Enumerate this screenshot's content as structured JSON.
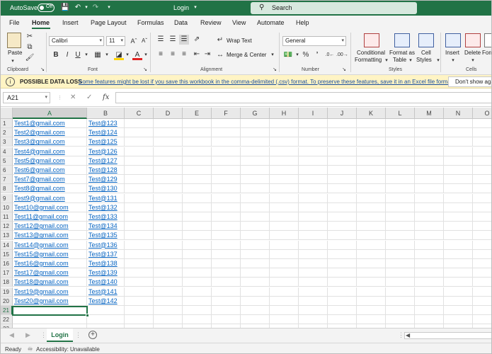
{
  "titlebar": {
    "autosave_label": "AutoSave",
    "autosave_state": "Off",
    "title": "Login",
    "search_placeholder": "Search"
  },
  "tabs": [
    "File",
    "Home",
    "Insert",
    "Page Layout",
    "Formulas",
    "Data",
    "Review",
    "View",
    "Automate",
    "Help"
  ],
  "active_tab": "Home",
  "ribbon": {
    "paste_label": "Paste",
    "clipboard_group": "Clipboard",
    "font_name": "Calibri",
    "font_size": "11",
    "bold": "B",
    "italic": "I",
    "underline": "U",
    "font_group": "Font",
    "wrap_text": "Wrap Text",
    "merge_center": "Merge & Center",
    "alignment_group": "Alignment",
    "number_format": "General",
    "number_group": "Number",
    "conditional_formatting_1": "Conditional",
    "conditional_formatting_2": "Formatting",
    "format_as_table_1": "Format as",
    "format_as_table_2": "Table",
    "cell_styles_1": "Cell",
    "cell_styles_2": "Styles",
    "styles_group": "Styles",
    "insert": "Insert",
    "delete": "Delete",
    "format": "Form",
    "cells_group": "Cells"
  },
  "infobar": {
    "heading": "POSSIBLE DATA LOSS",
    "message": "Some features might be lost if you save this workbook in the comma-delimited (.csv) format. To preserve these features, save it in an Excel file format.",
    "button": "Don't show aga"
  },
  "formula_bar": {
    "name_box": "A21",
    "fx": "fx",
    "value": ""
  },
  "columns": [
    "A",
    "B",
    "C",
    "D",
    "E",
    "F",
    "G",
    "H",
    "I",
    "J",
    "K",
    "L",
    "M",
    "N",
    "O"
  ],
  "rows": [
    [
      "Test1@gmail.com",
      "Test@123"
    ],
    [
      "Test2@gmail.com",
      "Test@124"
    ],
    [
      "Test3@gmail.com",
      "Test@125"
    ],
    [
      "Test4@gmail.com",
      "Test@126"
    ],
    [
      "Test5@gmail.com",
      "Test@127"
    ],
    [
      "Test6@gmail.com",
      "Test@128"
    ],
    [
      "Test7@gmail.com",
      "Test@129"
    ],
    [
      "Test8@gmail.com",
      "Test@130"
    ],
    [
      "Test9@gmail.com",
      "Test@131"
    ],
    [
      "Test10@gmail.com",
      "Test@132"
    ],
    [
      "Test11@gmail.com",
      "Test@133"
    ],
    [
      "Test12@gmail.com",
      "Test@134"
    ],
    [
      "Test13@gmail.com",
      "Test@135"
    ],
    [
      "Test14@gmail.com",
      "Test@136"
    ],
    [
      "Test15@gmail.com",
      "Test@137"
    ],
    [
      "Test16@gmail.com",
      "Test@138"
    ],
    [
      "Test17@gmail.com",
      "Test@139"
    ],
    [
      "Test18@gmail.com",
      "Test@140"
    ],
    [
      "Test19@gmail.com",
      "Test@141"
    ],
    [
      "Test20@gmail.com",
      "Test@142"
    ],
    [
      "",
      ""
    ],
    [
      "",
      ""
    ],
    [
      "",
      ""
    ]
  ],
  "sheet_tab": "Login",
  "status": {
    "ready": "Ready",
    "accessibility": "Accessibility: Unavailable"
  },
  "colors": {
    "accent": "#217346",
    "link": "#0563c1",
    "infobar": "#fff4c4"
  }
}
